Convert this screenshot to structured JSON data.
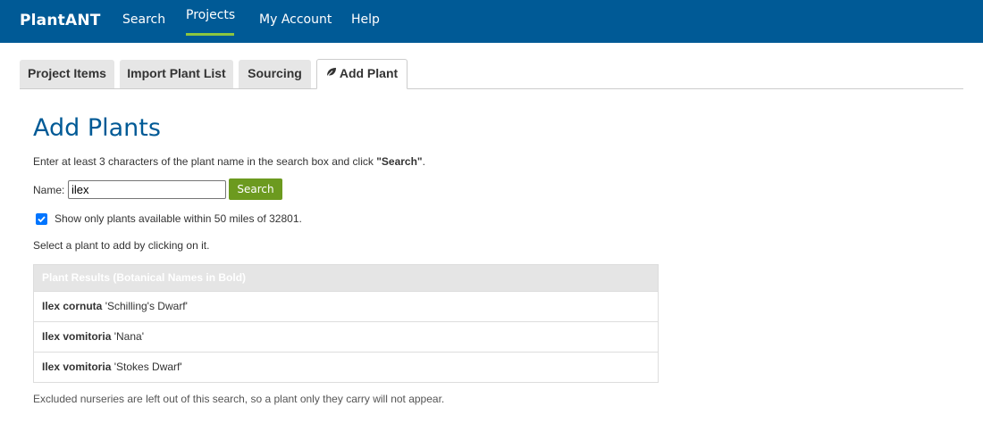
{
  "nav": {
    "brand": "PlantANT",
    "items": [
      {
        "label": "Search"
      },
      {
        "label": "Projects"
      },
      {
        "label": "My Account"
      },
      {
        "label": "Help"
      }
    ],
    "active": "Projects",
    "colors": {
      "bar": "#005a96",
      "active_underline": "#8dc63f"
    }
  },
  "tabs": [
    {
      "label": "Project Items"
    },
    {
      "label": "Import Plant List"
    },
    {
      "label": "Sourcing"
    },
    {
      "label": "Add Plant",
      "icon": "leaf-icon"
    }
  ],
  "active_tab": "Add Plant",
  "main": {
    "title": "Add Plants",
    "instructions_prefix": "Enter at least 3 characters of the plant name in the search box and click ",
    "instructions_bold": "\"Search\"",
    "instructions_suffix": ".",
    "name_label": "Name:",
    "name_value": "ilex",
    "search_label": "Search",
    "availability_checked": true,
    "availability_label": "Show only plants available within 50 miles of 32801.",
    "select_hint": "Select a plant to add by clicking on it.",
    "results_header": "Plant Results (Botanical Names in Bold)",
    "results": [
      {
        "botanical": "Ilex cornuta",
        "cultivar": "'Schilling's Dwarf'"
      },
      {
        "botanical": "Ilex vomitoria",
        "cultivar": "'Nana'"
      },
      {
        "botanical": "Ilex vomitoria",
        "cultivar": "'Stokes Dwarf'"
      }
    ],
    "footnote": "Excluded nurseries are left out of this search, so a plant only they carry will not appear."
  }
}
